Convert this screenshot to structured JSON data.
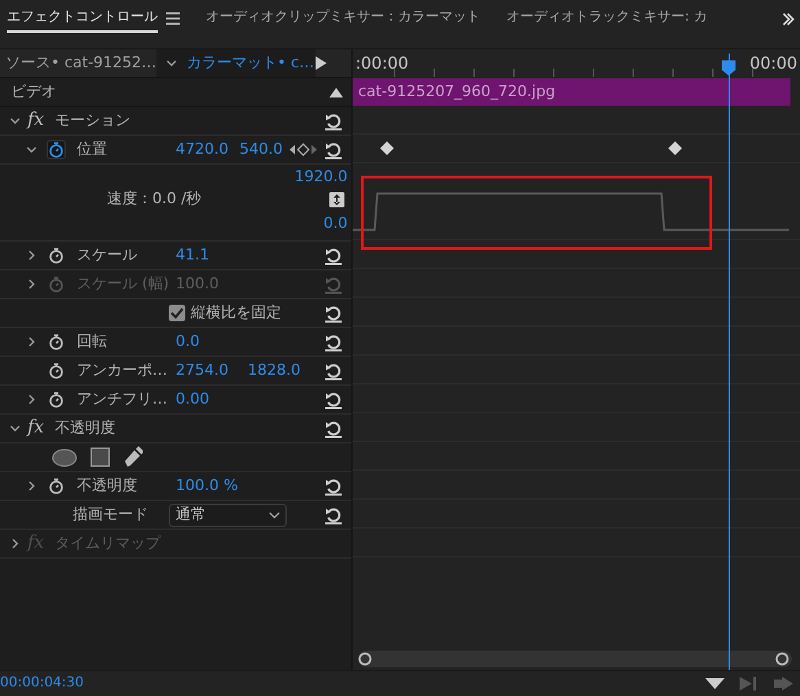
{
  "tabs": [
    {
      "label": "エフェクトコントロール",
      "selected": true,
      "menu": true
    },
    {
      "label": "オーディオクリップミキサー：カラーマット",
      "selected": false,
      "menu": false
    },
    {
      "label": "オーディオトラックミキサー: カ",
      "selected": false,
      "menu": false
    }
  ],
  "source_bar": {
    "source": "ソース• cat-91252…",
    "clip": "カラーマット• c…"
  },
  "timeline": {
    "start": ":00:00",
    "end": "00:00",
    "clip": "cat-9125207_960_720.jpg",
    "playhead": {
      "level": 0.86
    }
  },
  "group": "ビデオ",
  "rows": [
    {
      "kind": "effect",
      "badge": "fx",
      "name": "モーション",
      "expanded": true,
      "enabled": true
    },
    {
      "kind": "property",
      "name": "位置",
      "values": [
        "4720.0",
        "540.0"
      ],
      "expanded": true,
      "animated": true,
      "disabled": false,
      "keyframes": [
        {
          "level": 0.06
        },
        {
          "level": 0.72
        }
      ]
    },
    {
      "kind": "graph",
      "max": "1920.0",
      "label": "速度：0.0 /秒",
      "min": "0.0"
    },
    {
      "kind": "property",
      "name": "スケール",
      "values": [
        "41.1"
      ],
      "expanded": false,
      "animated": false,
      "disabled": false
    },
    {
      "kind": "property",
      "name": "スケール (幅)",
      "values": [
        "100.0"
      ],
      "expanded": false,
      "animated": false,
      "disabled": true
    },
    {
      "kind": "checkbox",
      "label": "縦横比を固定",
      "checked": true
    },
    {
      "kind": "property",
      "name": "回転",
      "values": [
        "0.0"
      ],
      "expanded": false,
      "animated": false,
      "disabled": false
    },
    {
      "kind": "property",
      "name": "アンカーポ…",
      "values": [
        "2754.0",
        "1828.0"
      ],
      "expanded": null,
      "animated": false,
      "disabled": false
    },
    {
      "kind": "property",
      "name": "アンチフリ…",
      "values": [
        "0.00"
      ],
      "expanded": false,
      "animated": false,
      "disabled": false
    },
    {
      "kind": "effect",
      "badge": "fx",
      "name": "不透明度",
      "expanded": true,
      "enabled": true
    },
    {
      "kind": "shapes"
    },
    {
      "kind": "property",
      "name": "不透明度",
      "values": [
        "100.0 %"
      ],
      "expanded": false,
      "animated": false,
      "disabled": false
    },
    {
      "kind": "dropdown",
      "label": "描画モード",
      "value": "通常"
    },
    {
      "kind": "effect",
      "badge": "fx",
      "name": "タイムリマップ",
      "expanded": false,
      "enabled": false
    }
  ],
  "timecode": "00:00:04:30"
}
